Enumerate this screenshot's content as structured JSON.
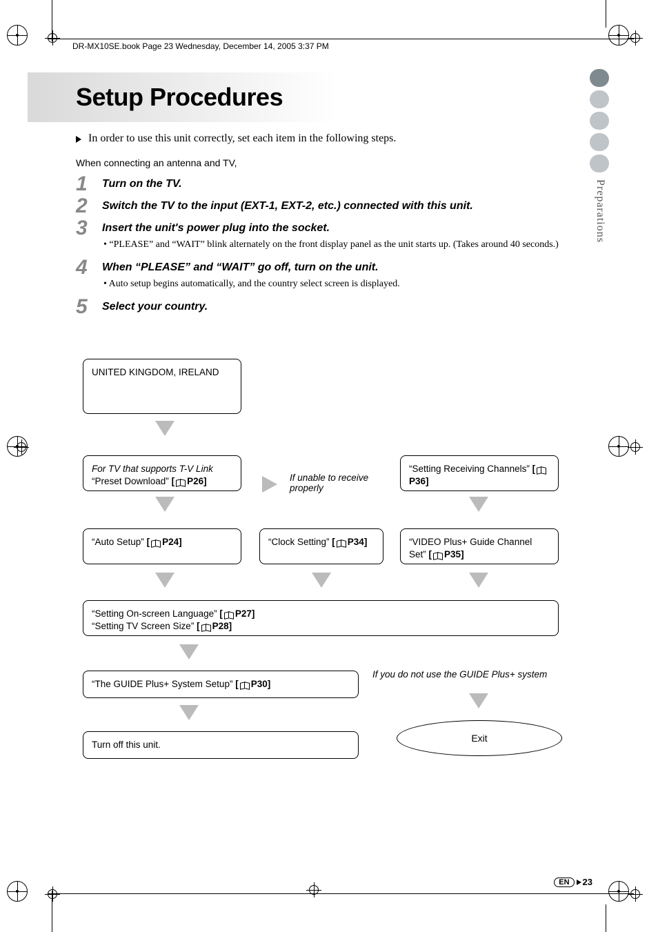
{
  "header": "DR-MX10SE.book  Page 23  Wednesday, December 14, 2005  3:37 PM",
  "title": "Setup Procedures",
  "intro": "In order to use this unit correctly, set each item in the following steps.",
  "subline": "When connecting an antenna and TV,",
  "side_section": "Preparations",
  "steps": [
    {
      "num": "1",
      "title": "Turn on the TV."
    },
    {
      "num": "2",
      "title": "Switch the TV to the input (EXT-1, EXT-2, etc.) connected with this unit."
    },
    {
      "num": "3",
      "title": "Insert the unit's power plug into the socket.",
      "body": "“PLEASE” and “WAIT” blink alternately on the front display panel as the unit starts up. (Takes around 40 seconds.)"
    },
    {
      "num": "4",
      "title": "When “PLEASE” and “WAIT” go off, turn on the unit.",
      "body": "Auto setup begins automatically, and the country select screen is displayed."
    },
    {
      "num": "5",
      "title": "Select your country."
    }
  ],
  "flow": {
    "country": "UNITED KINGDOM, IRELAND",
    "tvlink_note": "For TV that supports T-V Link",
    "preset_download_text": "“Preset Download”",
    "preset_download_ref": "P26",
    "unable_receive": "If unable to receive properly",
    "setting_channels_text": "“Setting Receiving Channels”",
    "setting_channels_ref": "P36",
    "auto_setup_text": "“Auto Setup”",
    "auto_setup_ref": "P24",
    "clock_text": "“Clock Setting”",
    "clock_ref": "P34",
    "vplus_text": "“VIDEO Plus+ Guide Channel Set”",
    "vplus_ref": "P35",
    "lang_text": "“Setting On-screen Language”",
    "lang_ref": "P27",
    "tvsize_text": "“Setting TV Screen Size”",
    "tvsize_ref": "P28",
    "guide_text": "“The GUIDE Plus+ System Setup”",
    "guide_ref": "P30",
    "no_guide_note": "If you do not use the GUIDE Plus+ system",
    "turn_off": "Turn off this unit.",
    "exit": "Exit"
  },
  "footer": {
    "lang": "EN",
    "page": "23"
  }
}
